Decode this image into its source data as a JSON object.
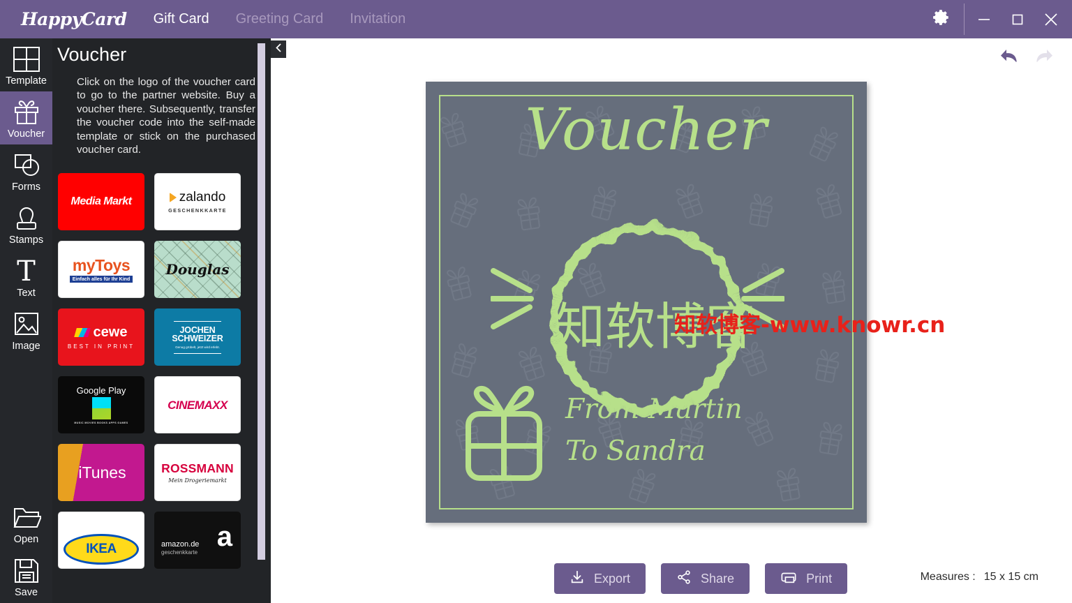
{
  "titlebar": {
    "logo": "HappyCard",
    "tabs": [
      {
        "label": "Gift Card",
        "active": true
      },
      {
        "label": "Greeting Card",
        "active": false
      },
      {
        "label": "Invitation",
        "active": false
      }
    ],
    "settings_icon": "gear-icon",
    "minimize_label": "—",
    "maximize_label": "□",
    "close_label": "✕",
    "accent_color": "#6b5b8e"
  },
  "rail": {
    "items": [
      {
        "label": "Template",
        "icon": "grid-icon",
        "active": false
      },
      {
        "label": "Voucher",
        "icon": "gift-icon",
        "active": true
      },
      {
        "label": "Forms",
        "icon": "shapes-icon",
        "active": false
      },
      {
        "label": "Stamps",
        "icon": "stamp-icon",
        "active": false
      },
      {
        "label": "Text",
        "icon": "text-t-icon",
        "active": false
      },
      {
        "label": "Image",
        "icon": "picture-icon",
        "active": false
      }
    ],
    "bottom_items": [
      {
        "label": "Open",
        "icon": "folder-icon"
      },
      {
        "label": "Save",
        "icon": "floppy-disk-icon"
      }
    ]
  },
  "panel": {
    "title": "Voucher",
    "description": "Click on the logo of the voucher card to go to the partner website. Buy a voucher there. Subsequently, transfer the voucher code into the self-made template or stick on the purchased voucher card.",
    "collapse_icon": "chevron-left-icon",
    "tiles": [
      {
        "name": "MediaMarkt",
        "text": "Media Markt",
        "bg": "#ff0000",
        "fg": "#ffffff",
        "subtitle": ""
      },
      {
        "name": "zalando",
        "text": "zalando",
        "bg": "#ffffff",
        "fg": "#1a1a1a",
        "subtitle": "GESCHENKKARTE"
      },
      {
        "name": "myToys",
        "text": "myToys",
        "bg": "#ffffff",
        "fg": "#e8531f",
        "subtitle": "Einfach alles für Ihr Kind"
      },
      {
        "name": "Douglas",
        "text": "Douglas",
        "bg": "#b9ddcb",
        "fg": "#111111",
        "subtitle": ""
      },
      {
        "name": "cewe",
        "text": "cewe",
        "bg": "#e8141c",
        "fg": "#ffffff",
        "subtitle": "BEST IN PRINT"
      },
      {
        "name": "JochenSchweizer",
        "text": "JOCHEN SCHWEIZER",
        "bg": "#0d7ba5",
        "fg": "#ffffff",
        "subtitle": "Genug grübelt, jetzt wird erlebt."
      },
      {
        "name": "GooglePlay",
        "text": "Google Play",
        "bg": "#0a0a0a",
        "fg": "#ffffff",
        "subtitle": "MUSIC MOVIES BOOKS APPS GAMES"
      },
      {
        "name": "Cinemaxx",
        "text": "CINEMAXX",
        "bg": "#ffffff",
        "fg": "#d4004e",
        "subtitle": ""
      },
      {
        "name": "iTunes",
        "text": "iTunes",
        "bg": "#c2188f",
        "fg": "#ffffff",
        "subtitle": ""
      },
      {
        "name": "Rossmann",
        "text": "ROSSMANN",
        "bg": "#ffffff",
        "fg": "#d6003c",
        "subtitle": "Mein Drogeriemarkt"
      },
      {
        "name": "Ikea",
        "text": "IKEA",
        "bg": "#ffffff",
        "fg": "#0051ba",
        "subtitle": ""
      },
      {
        "name": "Amazon",
        "text": "amazon.de",
        "bg": "#101010",
        "fg": "#ffffff",
        "subtitle": "geschenkkarte"
      }
    ]
  },
  "stage": {
    "undo_icon": "undo-arrow-icon",
    "redo_icon": "redo-arrow-icon",
    "undo_enabled": "true",
    "redo_enabled": "false"
  },
  "card": {
    "title": "Voucher",
    "line1": "From Martin",
    "line2": "To Sandra",
    "background_color": "#666e7c",
    "accent_color": "#b7e08a",
    "pattern": "gift-boxes",
    "watermark_green": "知软博客",
    "watermark_red": "知软博客-www.knowr.cn"
  },
  "actions": {
    "export_label": "Export",
    "export_icon": "download-icon",
    "share_label": "Share",
    "share_icon": "share-nodes-icon",
    "print_label": "Print",
    "print_icon": "printer-icon",
    "measures_label": "Measures :",
    "measures_value": "15 x 15 cm"
  }
}
